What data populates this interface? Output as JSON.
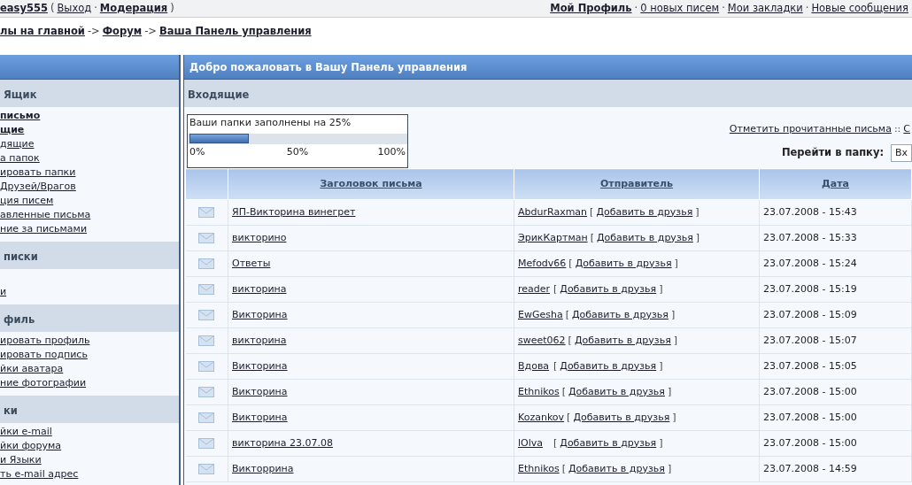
{
  "top_bar": {
    "left": [
      {
        "kind": "link",
        "text": "easy555",
        "bold": true
      },
      {
        "kind": "text",
        "text": "("
      },
      {
        "kind": "link",
        "text": "Выход",
        "bold": false
      },
      {
        "kind": "text",
        "text": "·"
      },
      {
        "kind": "link",
        "text": "Модерация",
        "bold": true
      },
      {
        "kind": "text",
        "text": ")"
      }
    ],
    "right": [
      {
        "kind": "link",
        "text": "Мой Профиль",
        "bold": true
      },
      {
        "kind": "text",
        "text": "·"
      },
      {
        "kind": "link",
        "text": "0 новых писем",
        "bold": false
      },
      {
        "kind": "text",
        "text": "·"
      },
      {
        "kind": "link",
        "text": "Мои закладки",
        "bold": false
      },
      {
        "kind": "text",
        "text": "·"
      },
      {
        "kind": "link",
        "text": "Новые сообщения",
        "bold": false
      }
    ]
  },
  "breadcrumb": [
    {
      "kind": "link",
      "text": "лы на главной",
      "bold": true
    },
    {
      "kind": "text",
      "text": "->"
    },
    {
      "kind": "link",
      "text": "Форум",
      "bold": true
    },
    {
      "kind": "text",
      "text": "->"
    },
    {
      "kind": "link",
      "text": "Ваша Панель управления",
      "bold": true
    }
  ],
  "sidebar": {
    "sections": [
      {
        "title": "Ящик",
        "items": [
          {
            "text": "письмо",
            "bold": true
          },
          {
            "text": "щие",
            "bold": true
          },
          {
            "text": "дящие",
            "bold": false
          },
          {
            "text": "а папок",
            "bold": false
          },
          {
            "text": "ировать папки",
            "bold": false
          },
          {
            "text": " Друзей/Врагов",
            "bold": false
          },
          {
            "text": "ция писем",
            "bold": false
          },
          {
            "text": "авленные письма",
            "bold": false
          },
          {
            "text": "ние за письмами",
            "bold": false
          }
        ]
      },
      {
        "title": "писки",
        "items": [
          {
            "text": "и",
            "bold": false
          }
        ]
      },
      {
        "title": "филь",
        "items": [
          {
            "text": "ировать профиль",
            "bold": false
          },
          {
            "text": "ировать подпись",
            "bold": false
          },
          {
            "text": "йки аватара",
            "bold": false
          },
          {
            "text": "ние фотографии",
            "bold": false
          }
        ]
      },
      {
        "title": "ки",
        "items": [
          {
            "text": "йки e-mail",
            "bold": false
          },
          {
            "text": "йки форума",
            "bold": false
          },
          {
            "text": "и Языки",
            "bold": false
          },
          {
            "text": "ть e-mail адрес",
            "bold": false
          }
        ]
      }
    ]
  },
  "main": {
    "title": "Добро пожаловать в Вашу Панель управления",
    "folder_title": "Входящие",
    "usage": {
      "label": "Ваши папки заполнены на 25%",
      "level": 0.27,
      "scale": [
        "0%",
        "50%",
        "100%"
      ]
    },
    "mark_line": [
      {
        "kind": "link",
        "text": "Отметить прочитанные письма",
        "bold": false
      },
      {
        "kind": "text",
        "text": "::"
      },
      {
        "kind": "link",
        "text": "С",
        "bold": false
      }
    ],
    "jump": {
      "label": "Перейти в папку:",
      "value": "Вх"
    },
    "table": {
      "columns": [
        "Заголовок письма",
        "Отправитель",
        "Дата"
      ],
      "rows": [
        {
          "title": "ЯП-Викторина винегрет",
          "sender": "AbdurRaxman",
          "action": "Добавить в друзья",
          "open": "[",
          "close": "]",
          "date": "23.07.2008 - 15:43"
        },
        {
          "title": "викторино",
          "sender": "ЭрикКартман",
          "action": "Добавить в друзья",
          "open": "[",
          "close": "]",
          "date": "23.07.2008 - 15:33"
        },
        {
          "title": "Ответы",
          "sender": "Mefodv66",
          "action": "Добавить в друзья",
          "open": "[",
          "close": "]",
          "date": "23.07.2008 - 15:24"
        },
        {
          "title": "викторина",
          "sender": "reader",
          "action": "Добавить в друзья",
          "open": "[",
          "close": "]",
          "date": "23.07.2008 - 15:19"
        },
        {
          "title": "Викторина",
          "sender": "EwGesha",
          "action": "Добавить в друзья",
          "open": "[",
          "close": "]",
          "date": "23.07.2008 - 15:09"
        },
        {
          "title": "викторина",
          "sender": "sweet062",
          "action": "Добавить в друзья",
          "open": "[",
          "close": "]",
          "date": "23.07.2008 - 15:07"
        },
        {
          "title": "Викторина",
          "sender": "Вдова",
          "action": "Добавить в друзья",
          "open": "[",
          "close": "]",
          "date": "23.07.2008 - 15:05"
        },
        {
          "title": "Викторина",
          "sender": "Ethnikos",
          "action": "Добавить в друзья",
          "open": "[",
          "close": "]",
          "date": "23.07.2008 - 15:00"
        },
        {
          "title": "Викторина",
          "sender": "Kozankov",
          "action": "Добавить в друзья",
          "open": "[",
          "close": "]",
          "date": "23.07.2008 - 15:00"
        },
        {
          "title": "викторина 23.07.08",
          "sender": "lOlva",
          "action": "Добавить в друзья",
          "open": "[",
          "close": "]",
          "date": "23.07.2008 - 15:00"
        },
        {
          "title": "Викторрина",
          "sender": "Ethnikos",
          "action": "Добавить в друзья",
          "open": "[",
          "close": "]",
          "date": "23.07.2008 - 14:59"
        }
      ]
    }
  }
}
